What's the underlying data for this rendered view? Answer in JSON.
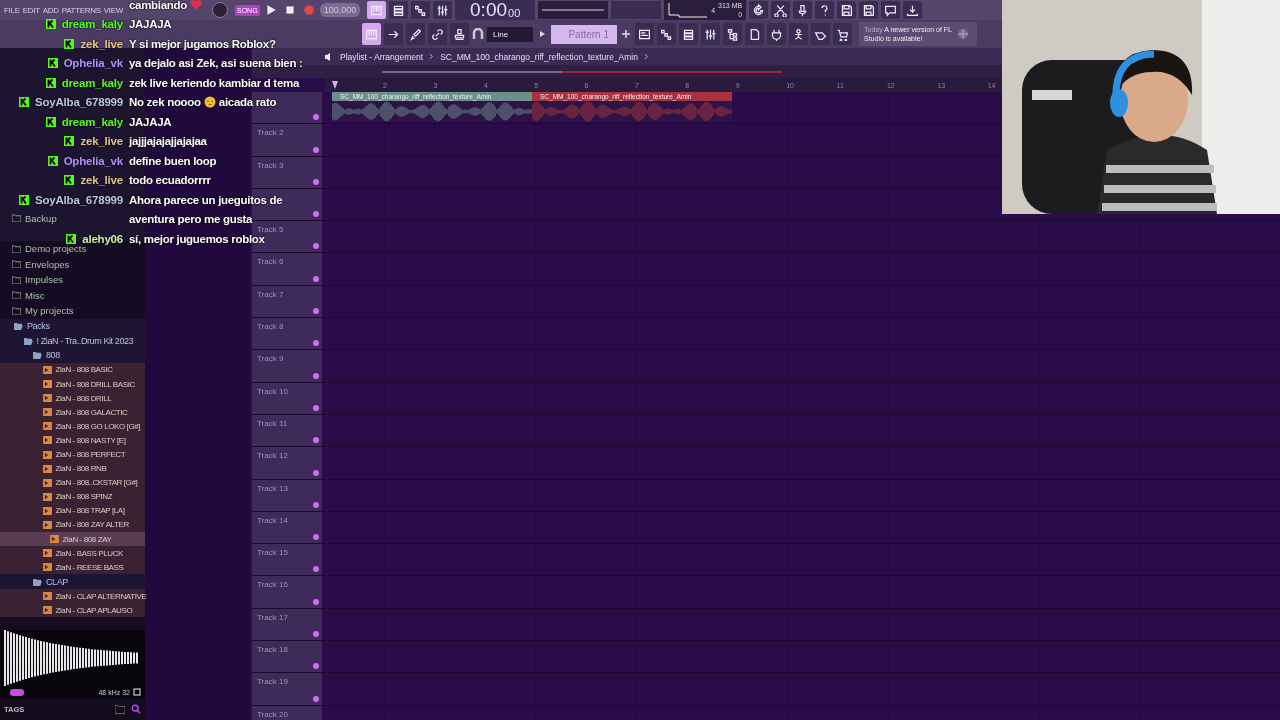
{
  "menu": [
    "FILE",
    "EDIT",
    "ADD",
    "PATTERNS",
    "VIEW"
  ],
  "transport": {
    "mode": "SONG",
    "tempo": "100.000",
    "time": "0:00",
    "time_small": "00",
    "cpu": "4",
    "memory": "313 MB",
    "polyphony": "0"
  },
  "snap": "Line",
  "pattern": "Pattern 1",
  "news": {
    "date": "Today",
    "text": "A newer version of FL Studio is available!"
  },
  "browser": {
    "pinned": {
      "label": "Backup"
    },
    "folders": [
      {
        "label": "Demo projects"
      },
      {
        "label": "Envelopes"
      },
      {
        "label": "Impulses"
      },
      {
        "label": "Misc"
      },
      {
        "label": "My projects"
      }
    ],
    "tree": [
      {
        "label": "Packs",
        "kind": "folder",
        "expanded": true,
        "children": [
          {
            "label": "! ZiaN - Tra..Drum Kit 2023",
            "kind": "folder",
            "expanded": true,
            "children": [
              {
                "label": "808",
                "kind": "folder",
                "expanded": true,
                "children": [
                  {
                    "label": "ZiaN - 808 BASIC",
                    "kind": "sample",
                    "selected": false
                  },
                  {
                    "label": "ZiaN - 808 DRILL BASIC",
                    "kind": "sample",
                    "selected": false
                  },
                  {
                    "label": "ZiaN - 808 DRILL",
                    "kind": "sample",
                    "selected": false
                  },
                  {
                    "label": "ZiaN - 808 GALACTIC",
                    "kind": "sample",
                    "selected": false
                  },
                  {
                    "label": "ZiaN - 808 GO LOKO [G#]",
                    "kind": "sample",
                    "selected": false
                  },
                  {
                    "label": "ZiaN - 808 NASTY [E]",
                    "kind": "sample",
                    "selected": false
                  },
                  {
                    "label": "ZiaN - 808 PERFECT",
                    "kind": "sample",
                    "selected": false
                  },
                  {
                    "label": "ZiaN - 808 RNB",
                    "kind": "sample",
                    "selected": false
                  },
                  {
                    "label": "ZiaN - 808..CKSTAR [G#]",
                    "kind": "sample",
                    "selected": false
                  },
                  {
                    "label": "ZiaN - 808 SPINZ",
                    "kind": "sample",
                    "selected": false
                  },
                  {
                    "label": "ZiaN - 808 TRAP [LA]",
                    "kind": "sample",
                    "selected": false
                  },
                  {
                    "label": "ZiaN - 808 ZAY ALTER",
                    "kind": "sample",
                    "selected": false
                  },
                  {
                    "label": "ZiaN - 808 ZAY",
                    "kind": "sample",
                    "selected": true
                  },
                  {
                    "label": "ZiaN - BASS PLUCK",
                    "kind": "sample",
                    "selected": false
                  },
                  {
                    "label": "ZiaN - REESE BASS",
                    "kind": "sample",
                    "selected": false
                  }
                ]
              },
              {
                "label": "CLAP",
                "kind": "folder",
                "expanded": true,
                "children": [
                  {
                    "label": "ZiaN - CLAP ALTERNATIVE",
                    "kind": "sample",
                    "selected": false
                  },
                  {
                    "label": "ZiaN - CLAP APLAUSO",
                    "kind": "sample",
                    "selected": false
                  }
                ]
              }
            ]
          }
        ]
      }
    ],
    "preview": {
      "format": "48 kHz 32"
    },
    "tags_label": "TAGS"
  },
  "playlist": {
    "title": "Playlist - Arrangement",
    "current": "SC_MM_100_charango_riff_reflection_texture_Amin",
    "ruler": [
      "2",
      "3",
      "4",
      "5",
      "6",
      "7",
      "8",
      "9",
      "10",
      "11",
      "12",
      "13",
      "14"
    ],
    "clips": [
      {
        "name": "SC_MM_100_charango_riff_reflection_texture_Amin",
        "color": "#6a8f8c"
      },
      {
        "name": "SC_MM_100_charango_riff_reflection_texture_Amin",
        "color": "#a8323f"
      }
    ],
    "tracks": [
      {
        "kind": "clips"
      },
      {
        "kind": "track",
        "label": "Track 2"
      },
      {
        "kind": "track",
        "label": "Track 3"
      },
      {
        "kind": "track"
      },
      {
        "kind": "track",
        "label": "Track 5"
      },
      {
        "kind": "track",
        "label": "Track 6"
      },
      {
        "kind": "track",
        "label": "Track 7"
      },
      {
        "kind": "track",
        "label": "Track 8"
      },
      {
        "kind": "track",
        "label": "Track 9"
      },
      {
        "kind": "track",
        "label": "Track 10"
      },
      {
        "kind": "track",
        "label": "Track 11"
      },
      {
        "kind": "track",
        "label": "Track 12"
      },
      {
        "kind": "track",
        "label": "Track 13"
      },
      {
        "kind": "track",
        "label": "Track 14"
      },
      {
        "kind": "track",
        "label": "Track 15"
      },
      {
        "kind": "track",
        "label": "Track 16"
      },
      {
        "kind": "track",
        "label": "Track 17"
      },
      {
        "kind": "track",
        "label": "Track 18"
      },
      {
        "kind": "track",
        "label": "Track 19"
      },
      {
        "kind": "track",
        "label": "Track 20"
      }
    ]
  },
  "chat": [
    {
      "parts": [
        {
          "kind": "text",
          "text": "cambiando"
        },
        {
          "kind": "heart"
        }
      ]
    },
    {
      "user": "dream_kaly",
      "color": "#53fc18",
      "parts": [
        {
          "kind": "text",
          "text": "JAJAJA"
        }
      ]
    },
    {
      "user": "zek_live",
      "color": "#e8c48a",
      "parts": [
        {
          "kind": "text",
          "text": "Y si mejor jugamos Roblox?"
        }
      ]
    },
    {
      "user": "Ophelia_vk",
      "color": "#b690ff",
      "parts": [
        {
          "kind": "text",
          "text": "ya dejalo asi Zek, asi suena bien :"
        }
      ]
    },
    {
      "user": "dream_kaly",
      "color": "#53fc18",
      "parts": [
        {
          "kind": "text",
          "text": "zek live keriendo kambiar d tema"
        }
      ]
    },
    {
      "user": "SoyAlba_678999",
      "color": "#b8c8e0",
      "parts": [
        {
          "kind": "text",
          "text": "No zek noooo"
        },
        {
          "kind": "emoji"
        },
        {
          "kind": "text",
          "text": "aicada rato"
        }
      ]
    },
    {
      "user": "dream_kaly",
      "color": "#53fc18",
      "parts": [
        {
          "kind": "text",
          "text": "JAJAJA"
        }
      ]
    },
    {
      "user": "zek_live",
      "color": "#e8c48a",
      "parts": [
        {
          "kind": "text",
          "text": "jajjjajajajjajajaa"
        }
      ]
    },
    {
      "user": "Ophelia_vk",
      "color": "#b690ff",
      "parts": [
        {
          "kind": "text",
          "text": "define buen loop"
        }
      ]
    },
    {
      "user": "zek_live",
      "color": "#e8c48a",
      "parts": [
        {
          "kind": "text",
          "text": "todo ecuadorrrr"
        }
      ]
    },
    {
      "user": "SoyAlba_678999",
      "color": "#b8c8e0",
      "parts": [
        {
          "kind": "text",
          "text": "Ahora parece un jueguitos de"
        },
        {
          "kind": "break"
        },
        {
          "kind": "text",
          "text": "aventura pero me gusta"
        }
      ]
    },
    {
      "user": "alehy06",
      "color": "#c8f0a0",
      "parts": [
        {
          "kind": "text",
          "text": "sí, mejor juguemos roblox"
        }
      ]
    }
  ]
}
